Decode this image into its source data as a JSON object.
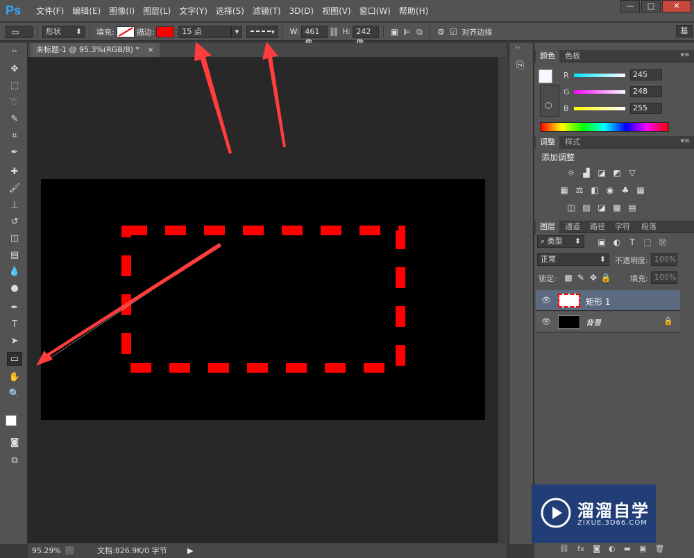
{
  "app": {
    "logo": "Ps"
  },
  "menu": [
    "文件(F)",
    "编辑(E)",
    "图像(I)",
    "图层(L)",
    "文字(Y)",
    "选择(S)",
    "滤镜(T)",
    "3D(D)",
    "视图(V)",
    "窗口(W)",
    "帮助(H)"
  ],
  "window_buttons": {
    "minimize": "—",
    "maximize": "□",
    "close": "✕"
  },
  "options": {
    "mode": "形状",
    "fill_label": "填充:",
    "stroke_label": "描边:",
    "stroke_color": "#ff0000",
    "stroke_width": "15 点",
    "w_label": "W:",
    "w_value": "461 像",
    "h_label": "H:",
    "h_value": "242 像",
    "align_edges": "对齐边缘",
    "workspace": "基"
  },
  "document_tab": {
    "title": "未标题-1 @ 95.3%(RGB/8) *",
    "close": "×"
  },
  "status_bar": {
    "zoom": "95.29%",
    "doc_info": "文档:826.9K/0 字节"
  },
  "color_panel": {
    "tabs": [
      "颜色",
      "色板"
    ],
    "channels": [
      {
        "name": "R",
        "value": "245",
        "color": "#00e5ff"
      },
      {
        "name": "G",
        "value": "248",
        "color": "#ff00ff"
      },
      {
        "name": "B",
        "value": "255",
        "color": "#ffff00"
      }
    ]
  },
  "adjust_panel": {
    "tabs": [
      "调整",
      "样式"
    ],
    "heading": "添加调整"
  },
  "layers_panel": {
    "tabs": [
      "图层",
      "通道",
      "路径",
      "字符",
      "段落"
    ],
    "filter": "类型",
    "blend_mode": "正常",
    "opacity_label": "不透明度:",
    "opacity_value": "100%",
    "lock_label": "锁定:",
    "fill_label": "填充:",
    "fill_value": "100%",
    "layers": [
      {
        "name": "矩形 1"
      },
      {
        "name": "背景"
      }
    ]
  },
  "watermark": {
    "title": "溜溜自学",
    "url": "ZIXUE.3D66.COM"
  },
  "colors": {
    "accent": "#ff0000",
    "panel": "#535353",
    "canvas_bg": "#282828"
  }
}
